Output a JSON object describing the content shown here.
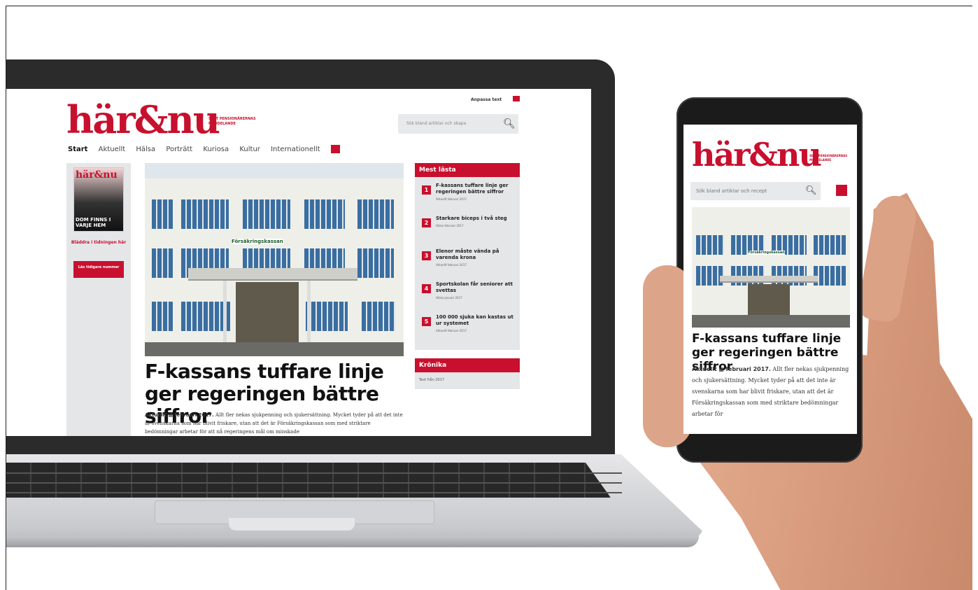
{
  "desktop": {
    "logo": "här&nu",
    "logo_tagline": "SEPT PENSIONÄRERNAS MEDDELANDE",
    "adjust_text": "Anpassa text",
    "search_placeholder": "Sök bland artiklar och skapa",
    "nav": [
      "Start",
      "Aktuellt",
      "Hälsa",
      "Porträtt",
      "Kuriosa",
      "Kultur",
      "Internationellt"
    ],
    "sidebar": {
      "mag_logo": "här&nu",
      "mag_headline": "DOM FINNS I VARJE HEM",
      "text": "Bläddra i tidningen här",
      "button": "Läs tidigare nummer"
    },
    "photo_sign": "Försäkringskassan",
    "headline": "F-kassans tuffare linje ger regeringen bättre siffror",
    "byline_section": "Aktuellt",
    "byline_date": "februari 2017.",
    "body": "Allt fler nekas sjukpenning och sjukersättning. Mycket tyder på att det inte är svenskarna som har blivit friskare, utan att det är Försäkringskassan som med striktare bedömningar arbetar för att nå regeringens mål om minskade",
    "rail": {
      "heading": "Mest lästa",
      "items": [
        {
          "num": "1",
          "title": "F-kassans tuffare linje ger regeringen bättre siffror",
          "meta": "Aktuellt  februari 2017"
        },
        {
          "num": "2",
          "title": "Starkare biceps i två steg",
          "meta": "Hälsa  februari 2017"
        },
        {
          "num": "3",
          "title": "Elenor måste vända på varenda krona",
          "meta": "Aktuellt  februari 2017"
        },
        {
          "num": "4",
          "title": "Sportskolan får seniorer att svettas",
          "meta": "Hälsa  januari 2017"
        },
        {
          "num": "5",
          "title": "100 000 sjuka kan kastas ut ur systemet",
          "meta": "Aktuellt  februari 2017"
        }
      ],
      "heading2": "Krönika",
      "small_text": "Text från 2017"
    }
  },
  "mobile": {
    "logo": "här&nu",
    "logo_tagline": "SEPT PENSIONÄRERNAS MEDDELANDE",
    "search_placeholder": "Sök bland artiklar och recept",
    "photo_sign": "Försäkringskassan",
    "headline": "F-kassans tuffare linje ger regeringen bättre siffror",
    "byline_section": "Aktuellt",
    "byline_date": "februari 2017.",
    "body": "Allt fler nekas sjukpenning och sjukersättning. Mycket tyder på att det inte är svenskarna som har blivit friskare, utan att det är Försäkringskassan som med striktare bedömningar arbetar för"
  },
  "colors": {
    "brand": "#c8102e",
    "rail_bg": "#e5e6e8"
  }
}
